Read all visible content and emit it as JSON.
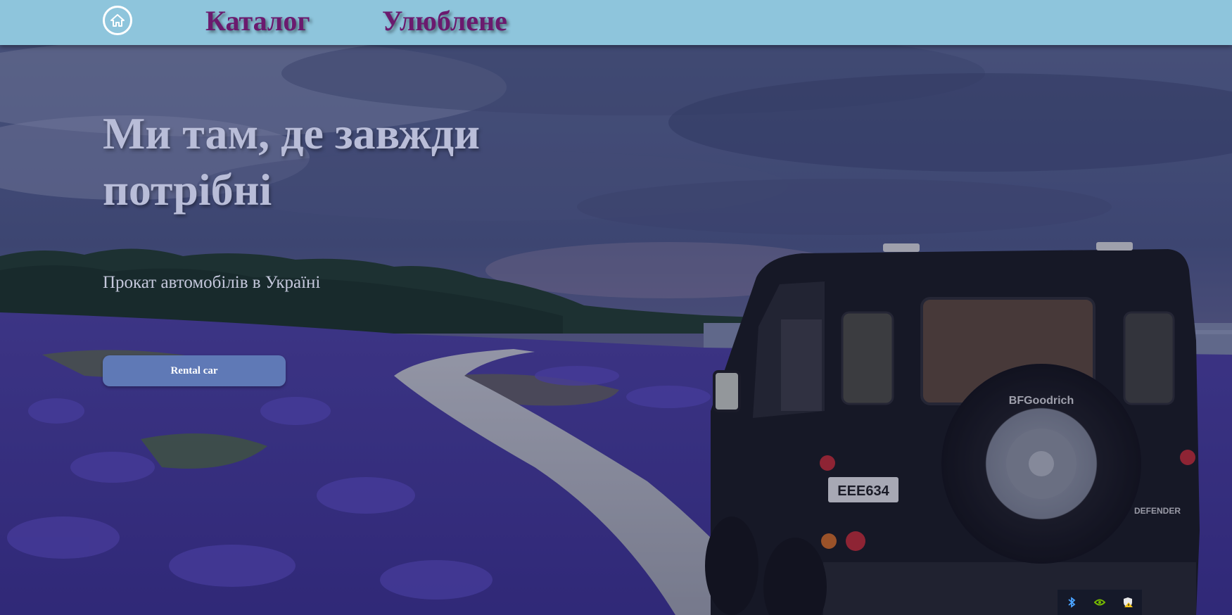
{
  "header": {
    "home_icon": "home-icon",
    "nav": {
      "catalog": "Каталог",
      "favorites": "Улюблене"
    }
  },
  "hero": {
    "title": "Ми там, де завжди потрібні",
    "subtitle": "Прокат автомобілів в Україні",
    "button_label": "Rental car",
    "background": "landscape photo: storm clouds, lavender field, gravel road, black off-road vehicle"
  },
  "colors": {
    "header_bg": "#8ec5dc",
    "nav_text": "#6b1a6e",
    "button_bg": "#5f79b6",
    "title_text": "#b9bdd8"
  },
  "tray": {
    "icons": [
      "bluetooth-icon",
      "nvidia-icon",
      "security-warning-icon"
    ]
  }
}
